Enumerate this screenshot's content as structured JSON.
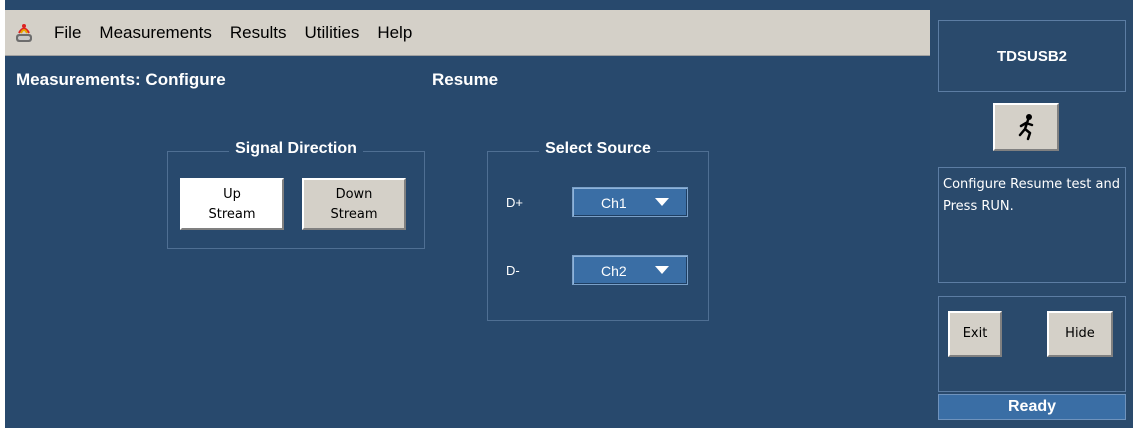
{
  "menu": {
    "items": [
      "File",
      "Measurements",
      "Results",
      "Utilities",
      "Help"
    ]
  },
  "page": {
    "title": "Measurements: Configure",
    "test_name": "Resume"
  },
  "signal_direction": {
    "legend": "Signal Direction",
    "up_line1": "Up",
    "up_line2": "Stream",
    "down_line1": "Down",
    "down_line2": "Stream",
    "selected": "Up Stream"
  },
  "select_source": {
    "legend": "Select Source",
    "dplus_label": "D+",
    "dplus_value": "Ch1",
    "dminus_label": "D-",
    "dminus_value": "Ch2"
  },
  "side": {
    "header": "TDSUSB2",
    "run_icon": "running-man-icon",
    "message": "Configure Resume test and Press RUN.",
    "exit_label": "Exit",
    "hide_label": "Hide",
    "status": "Ready"
  },
  "colors": {
    "background": "#28496d",
    "menubar": "#d4d0c8",
    "accent": "#3a6ea5"
  }
}
